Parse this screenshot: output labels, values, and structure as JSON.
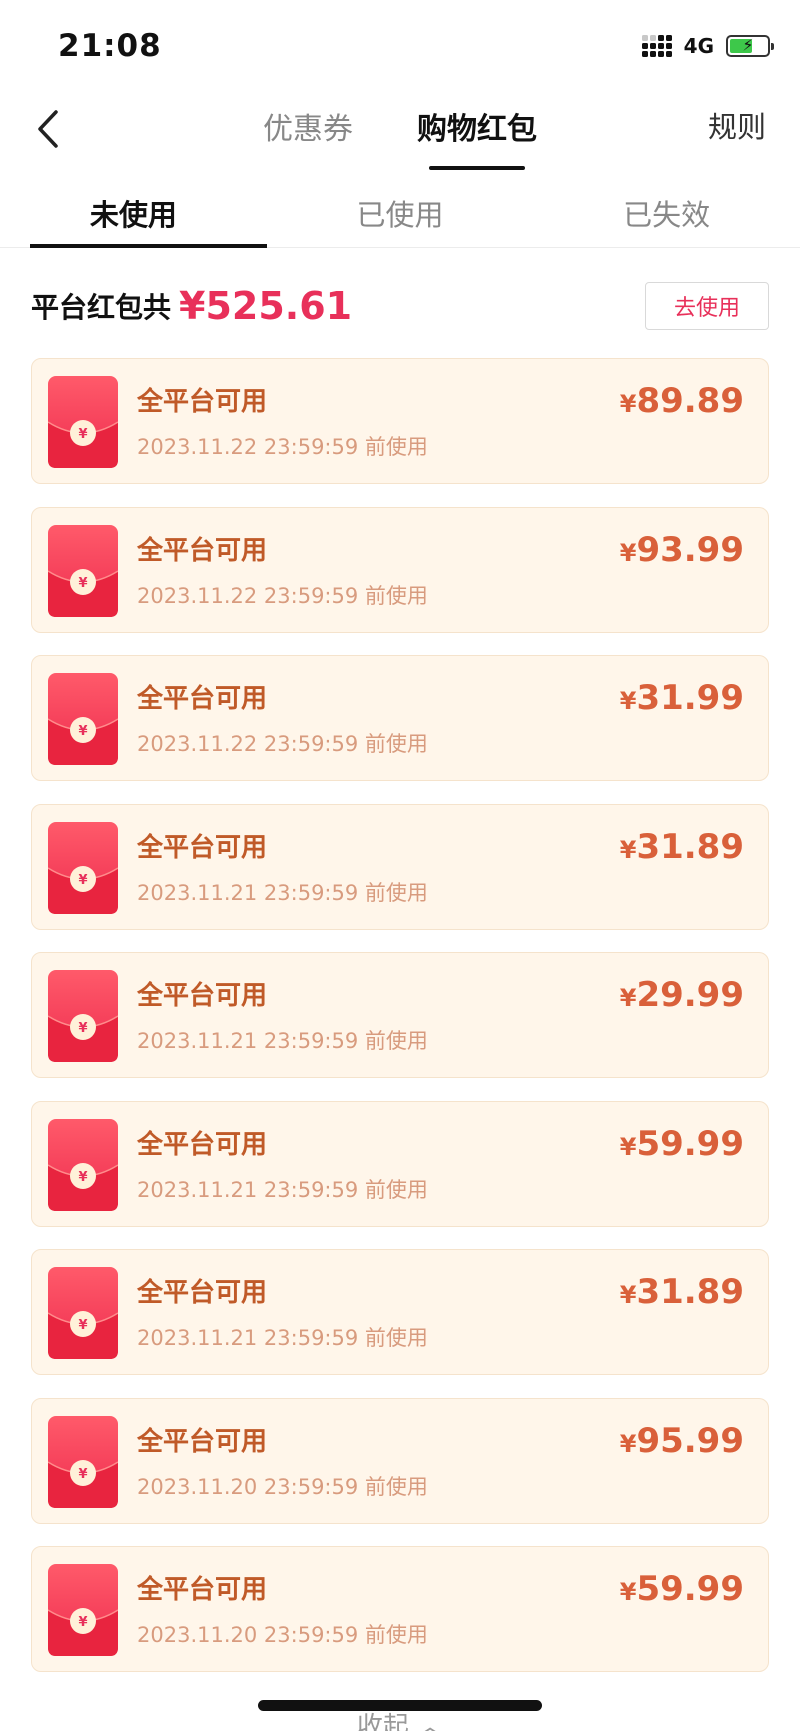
{
  "status_bar": {
    "time": "21:08",
    "network": "4G"
  },
  "header": {
    "tabs": [
      {
        "label": "优惠券",
        "active": false
      },
      {
        "label": "购物红包",
        "active": true
      }
    ],
    "rules_label": "规则"
  },
  "sub_tabs": [
    {
      "label": "未使用",
      "active": true
    },
    {
      "label": "已使用",
      "active": false
    },
    {
      "label": "已失效",
      "active": false
    }
  ],
  "summary": {
    "label": "平台红包共",
    "amount": "¥525.61",
    "use_button": "去使用"
  },
  "packets": [
    {
      "title": "全平台可用",
      "expiry": "2023.11.22 23:59:59 前使用",
      "amount": "89.89"
    },
    {
      "title": "全平台可用",
      "expiry": "2023.11.22 23:59:59 前使用",
      "amount": "93.99"
    },
    {
      "title": "全平台可用",
      "expiry": "2023.11.22 23:59:59 前使用",
      "amount": "31.99"
    },
    {
      "title": "全平台可用",
      "expiry": "2023.11.21 23:59:59 前使用",
      "amount": "31.89"
    },
    {
      "title": "全平台可用",
      "expiry": "2023.11.21 23:59:59 前使用",
      "amount": "29.99"
    },
    {
      "title": "全平台可用",
      "expiry": "2023.11.21 23:59:59 前使用",
      "amount": "59.99"
    },
    {
      "title": "全平台可用",
      "expiry": "2023.11.21 23:59:59 前使用",
      "amount": "31.89"
    },
    {
      "title": "全平台可用",
      "expiry": "2023.11.20 23:59:59 前使用",
      "amount": "95.99"
    },
    {
      "title": "全平台可用",
      "expiry": "2023.11.20 23:59:59 前使用",
      "amount": "59.99"
    }
  ],
  "currency_symbol": "¥",
  "footer": {
    "collapse_label": "收起 ︿"
  },
  "icons": {
    "back": "chevron-left-icon",
    "packet": "red-packet-icon",
    "signal": "signal-icon",
    "battery": "battery-charging-icon"
  },
  "colors": {
    "accent": "#e8305a",
    "card_background": "#fff6ea",
    "card_title": "#c05a28",
    "card_amount": "#d9603a",
    "packet_red": "#ee2d4f"
  }
}
